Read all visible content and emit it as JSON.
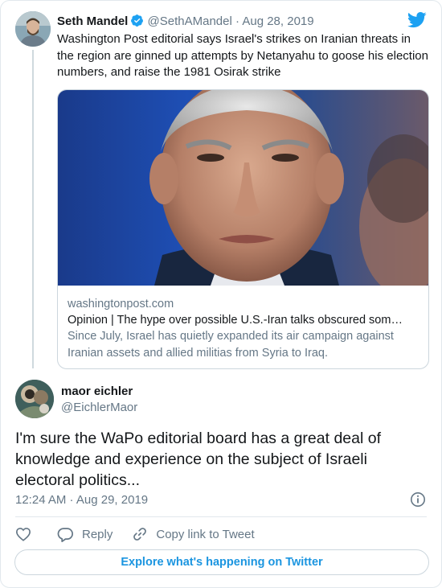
{
  "colors": {
    "accent": "#1b95e0",
    "twitter_blue": "#1da1f2",
    "text_primary": "#14171a",
    "text_secondary": "#657786",
    "border": "#e1e8ed"
  },
  "parent_tweet": {
    "author_name": "Seth Mandel",
    "handle": "@SethAMandel",
    "separator": "·",
    "date": "Aug 28, 2019",
    "verified_icon": "verified-badge-icon",
    "text": "Washington Post editorial says Israel's strikes on Iranian threats in the region are ginned up attempts by Netanyahu to goose his election numbers, and raise the 1981 Osirak strike",
    "link_card": {
      "domain": "washingtonpost.com",
      "title": "Opinion | The hype over possible U.S.-Iran talks obscured som…",
      "description": "Since July, Israel has quietly expanded its air campaign against Iranian assets and allied militias from Syria to Iraq."
    }
  },
  "main_tweet": {
    "author_name": "maor eichler",
    "handle": "@EichlerMaor",
    "text": "I'm sure the WaPo editorial board has a great deal of knowledge and experience on the subject of Israeli electoral politics...",
    "timestamp": "12:24 AM · Aug 29, 2019"
  },
  "actions": {
    "like_icon": "heart-icon",
    "reply_icon": "reply-bubble-icon",
    "reply_label": "Reply",
    "copy_icon": "link-icon",
    "copy_label": "Copy link to Tweet"
  },
  "footer": {
    "explore_label": "Explore what's happening on Twitter"
  }
}
